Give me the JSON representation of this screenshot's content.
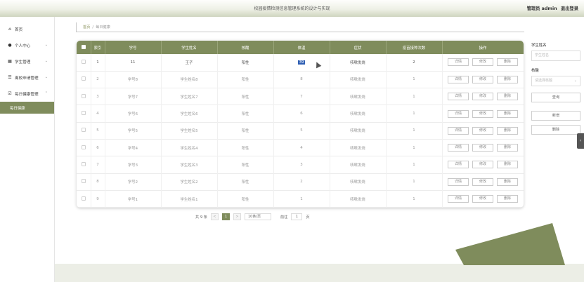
{
  "header": {
    "title": "校园疫情检测信息管理系统的设计与实现",
    "user": "管理员 admin",
    "logout": "退出登录"
  },
  "sidebar": {
    "items": [
      {
        "label": "首页",
        "icon": "home-icon",
        "has_children": false
      },
      {
        "label": "个人中心",
        "icon": "person-icon",
        "has_children": true
      },
      {
        "label": "学生管理",
        "icon": "grid-icon",
        "has_children": true
      },
      {
        "label": "离校申请管理",
        "icon": "list-icon",
        "has_children": true
      },
      {
        "label": "每日健康管理",
        "icon": "checkbox-icon",
        "has_children": true,
        "expanded": true
      }
    ],
    "active_sub": "每日健康"
  },
  "breadcrumb": {
    "home": "首页",
    "separator": "/",
    "current": "每日健康"
  },
  "table": {
    "columns": [
      "索引",
      "学号",
      "学生姓名",
      "核酸",
      "体温",
      "症状",
      "疫苗接种次数",
      "操作"
    ],
    "rows": [
      {
        "idx": "1",
        "id": "11",
        "name": "王子",
        "nucleic": "阳性",
        "temp": "39",
        "symptom": "咳嗽发烧",
        "vaccine": "2"
      },
      {
        "idx": "2",
        "id": "学号8",
        "name": "学生姓名8",
        "nucleic": "阳性",
        "temp": "8",
        "symptom": "咳嗽发烧",
        "vaccine": "1"
      },
      {
        "idx": "3",
        "id": "学号7",
        "name": "学生姓名7",
        "nucleic": "阳性",
        "temp": "7",
        "symptom": "咳嗽发烧",
        "vaccine": "1"
      },
      {
        "idx": "4",
        "id": "学号6",
        "name": "学生姓名6",
        "nucleic": "阳性",
        "temp": "6",
        "symptom": "咳嗽发烧",
        "vaccine": "1"
      },
      {
        "idx": "5",
        "id": "学号5",
        "name": "学生姓名5",
        "nucleic": "阳性",
        "temp": "5",
        "symptom": "咳嗽发烧",
        "vaccine": "1"
      },
      {
        "idx": "6",
        "id": "学号4",
        "name": "学生姓名4",
        "nucleic": "阳性",
        "temp": "4",
        "symptom": "咳嗽发烧",
        "vaccine": "1"
      },
      {
        "idx": "7",
        "id": "学号3",
        "name": "学生姓名3",
        "nucleic": "阳性",
        "temp": "3",
        "symptom": "咳嗽发烧",
        "vaccine": "1"
      },
      {
        "idx": "8",
        "id": "学号2",
        "name": "学生姓名2",
        "nucleic": "阳性",
        "temp": "2",
        "symptom": "咳嗽发烧",
        "vaccine": "1"
      },
      {
        "idx": "9",
        "id": "学号1",
        "name": "学生姓名1",
        "nucleic": "阳性",
        "temp": "1",
        "symptom": "咳嗽发烧",
        "vaccine": "1"
      }
    ],
    "actions": {
      "detail": "详情",
      "edit": "修改",
      "delete": "删除"
    }
  },
  "pagination": {
    "total": "共 9 条",
    "prev": "<",
    "page": "1",
    "next": ">",
    "page_size": "10条/页",
    "goto_label": "前往",
    "goto_value": "1",
    "page_unit": "页"
  },
  "filter": {
    "student_name_label": "学生姓名",
    "student_name_placeholder": "学生姓名",
    "nucleic_label": "核酸",
    "nucleic_placeholder": "请选择核酸",
    "search_button": "查询",
    "add_button": "新增",
    "delete_button": "删除"
  },
  "colors": {
    "accent": "#7f8c5c",
    "header_gradient_end": "#cfd5bf",
    "highlight": "#2f5fb3"
  }
}
